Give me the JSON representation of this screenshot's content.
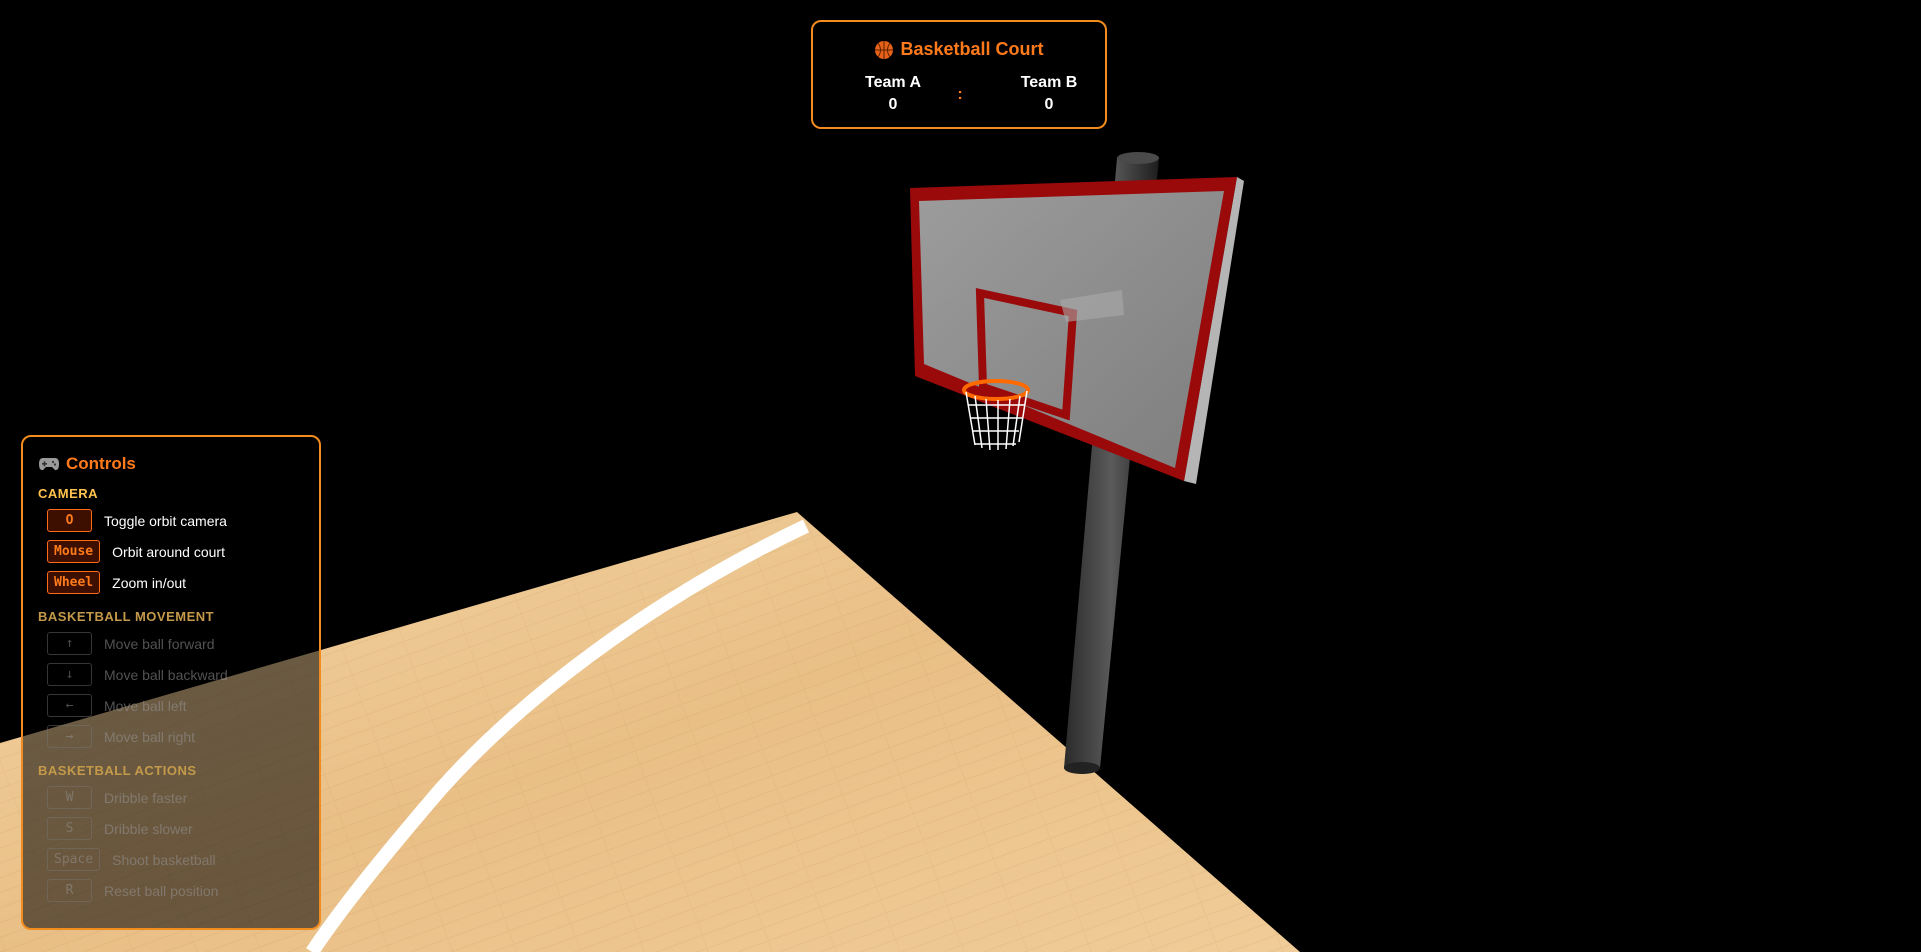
{
  "scoreboard": {
    "title": "Basketball Court",
    "icon": "basketball-icon",
    "team_a": {
      "name": "Team A",
      "score": "0"
    },
    "separator": ":",
    "team_b": {
      "name": "Team B",
      "score": "0"
    }
  },
  "controls": {
    "title": "Controls",
    "icon": "gamepad-icon",
    "sections": [
      {
        "title": "CAMERA",
        "items": [
          {
            "key": "O",
            "label": "Toggle orbit camera"
          },
          {
            "key": "Mouse",
            "label": "Orbit around court"
          },
          {
            "key": "Wheel",
            "label": "Zoom in/out"
          }
        ]
      },
      {
        "title": "BASKETBALL MOVEMENT",
        "items": [
          {
            "key": "↑",
            "label": "Move ball forward"
          },
          {
            "key": "↓",
            "label": "Move ball backward"
          },
          {
            "key": "←",
            "label": "Move ball left"
          },
          {
            "key": "→",
            "label": "Move ball right"
          }
        ]
      },
      {
        "title": "BASKETBALL ACTIONS",
        "items": [
          {
            "key": "W",
            "label": "Dribble faster"
          },
          {
            "key": "S",
            "label": "Dribble slower"
          },
          {
            "key": "Space",
            "label": "Shoot basketball"
          },
          {
            "key": "R",
            "label": "Reset ball position"
          }
        ]
      }
    ]
  },
  "colors": {
    "accent": "#ff7a1a",
    "panel_border": "#f28c1e",
    "court_wood": "#e8c38f",
    "backboard_border": "#9b0a0a",
    "rim": "#ff6a00"
  }
}
